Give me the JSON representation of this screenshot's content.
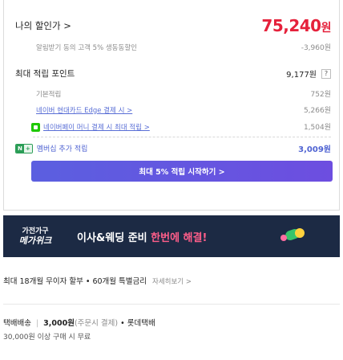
{
  "price_box": {
    "my_price_label": "나의 할인가 >",
    "my_price_value": "75,240",
    "won": "원",
    "coupon_text": "알림받기 동의 고객 5% 생동동할인",
    "coupon_value": "-3,960원",
    "max_points_label": "최대 적립 포인트",
    "max_points_value": "9,177원",
    "help_icon_text": "?",
    "basic_label": "기본적립",
    "basic_value": "752원",
    "naver_card_label": "네이버 현대카드 Edge 결제 시 >",
    "naver_card_value": "5,266원",
    "naverpay_label": "네이버페이 머니 결제 시 최대 적립 >",
    "naverpay_value": "1,504원",
    "membership_badge_n": "N",
    "membership_badge_plus": "+",
    "membership_label": "멤버십 추가 적립",
    "membership_value": "3,009원",
    "cta_label": "최대 5% 적립 시작하기 >"
  },
  "banner": {
    "logo_line1": "가전가구",
    "logo_line2": "메가위크",
    "text_main": "이사&웨딩 준비 ",
    "text_highlight": "한번에 해결!"
  },
  "installment": {
    "text": "최대 18개월 무이자 할부 • 60개월 특별금리",
    "more": "자세히보기 >"
  },
  "shipping": {
    "label": "택배배송",
    "fee": "3,000원",
    "fee_note": "(주문시 결제)",
    "carrier": "• 롯데택배",
    "free_condition": "30,000원 이상 구매 시 무료"
  },
  "colors": {
    "price_red": "#e5213b",
    "cta_purple": "#5b5fe0",
    "banner_bg": "#1c2a44",
    "membership_blue": "#4f63d2"
  }
}
